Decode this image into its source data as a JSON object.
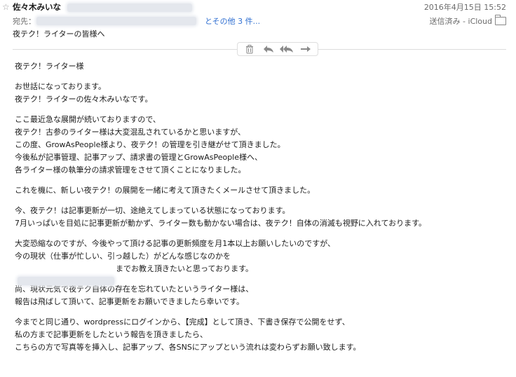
{
  "header": {
    "sender_name": "佐々木みいな",
    "date": "2016年4月15日 15:52",
    "to_label": "宛先：",
    "others_link": "とその他 3 件...",
    "status": "送信済み - iCloud",
    "subject": "夜テク！ライターの皆様へ"
  },
  "toolbar": {
    "icons": [
      "trash-icon",
      "reply-icon",
      "reply-all-icon",
      "forward-icon"
    ]
  },
  "body": {
    "greeting": "夜テク！ライター様",
    "p1": [
      "お世話になっております。",
      "夜テク！ライターの佐々木みいなです。"
    ],
    "p2": [
      "ここ最近急な展開が続いておりますので、",
      "夜テク！古参のライター様は大変混乱されているかと思いますが、",
      "この度、GrowAsPeople様より、夜テク！の管理を引き継がせて頂きました。",
      "今後私が記事管理、記事アップ、請求書の管理とGrowAsPeople様へ、",
      "各ライター様の執筆分の請求管理をさせて頂くことになりました。"
    ],
    "p3": [
      "これを機に、新しい夜テク！の展開を一緒に考えて頂きたくメールさせて頂きました。"
    ],
    "p4": [
      "今、夜テク！は記事更新が一切、途絶えてしまっている状態になっております。",
      "7月いっぱいを目処に記事更新が動かず、ライター数も動かない場合は、夜テク！自体の消滅も視野に入れております。"
    ],
    "p5": [
      "大変恐縮なのですが、今後やって頂ける記事の更新頻度を月1本以上お願いしたいのですが、",
      "今の現状（仕事が忙しい、引っ越した）がどんな感じなのかを",
      "までお教え頂きたいと思っております。"
    ],
    "p6": [
      "尚、現状元気で夜テク自体の存在を忘れていたというライター様は、",
      "報告は飛ばして頂いて、記事更新をお願いできましたら幸いです。"
    ],
    "p7": [
      "今までと同じ通り、wordpressにログインから、【完成】として頂き、下書き保存で公開をせず、",
      "私の方まで記事更新をしたという報告を頂きましたら、",
      "こちらの方で写真等を挿入し、記事アップ、各SNSにアップという流れは変わらずお願い致します。"
    ]
  }
}
